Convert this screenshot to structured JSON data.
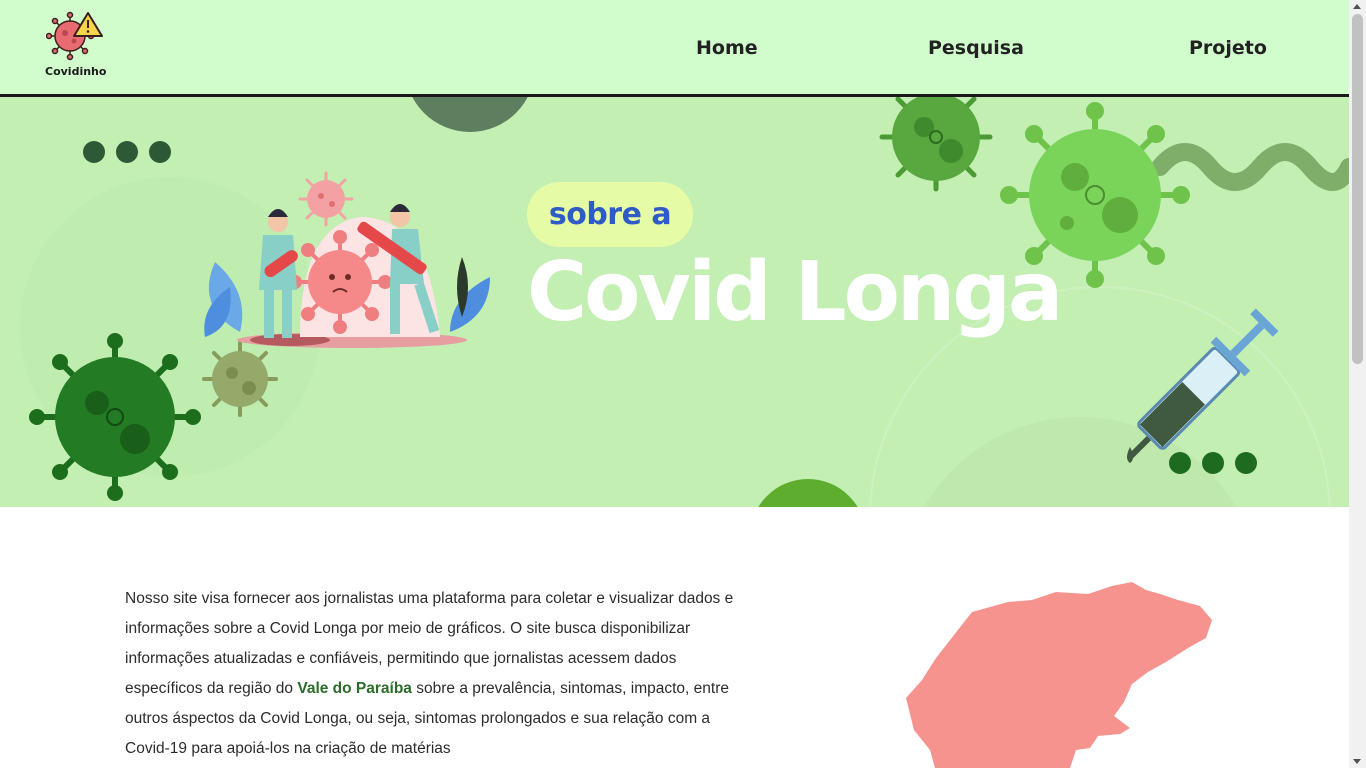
{
  "header": {
    "logo_text": "Covidinho",
    "nav": [
      {
        "label": "Home"
      },
      {
        "label": "Pesquisa"
      },
      {
        "label": "Projeto"
      }
    ]
  },
  "hero": {
    "pill_text": "sobre a",
    "title": "Covid Longa"
  },
  "content": {
    "paragraph_part1": "Nosso site visa fornecer aos jornalistas uma plataforma para coletar e visualizar dados e informações sobre a Covid Longa por meio de gráficos. O site busca disponibilizar informações atualizadas e confiáveis, permitindo que jornalistas acessem dados específicos da região do ",
    "highlight": "Vale do Paraíba",
    "paragraph_part2": " sobre a prevalência, sintomas, impacto, entre outros áspectos da Covid Longa, ou seja, sintomas prolongados e sua relação com a Covid-19 para apoiá-los na criação de matérias"
  },
  "colors": {
    "header_bg": "#d1fdcd",
    "hero_bg": "#c3efb3",
    "highlight": "#2c6b2a",
    "map_fill": "#f7938f"
  }
}
